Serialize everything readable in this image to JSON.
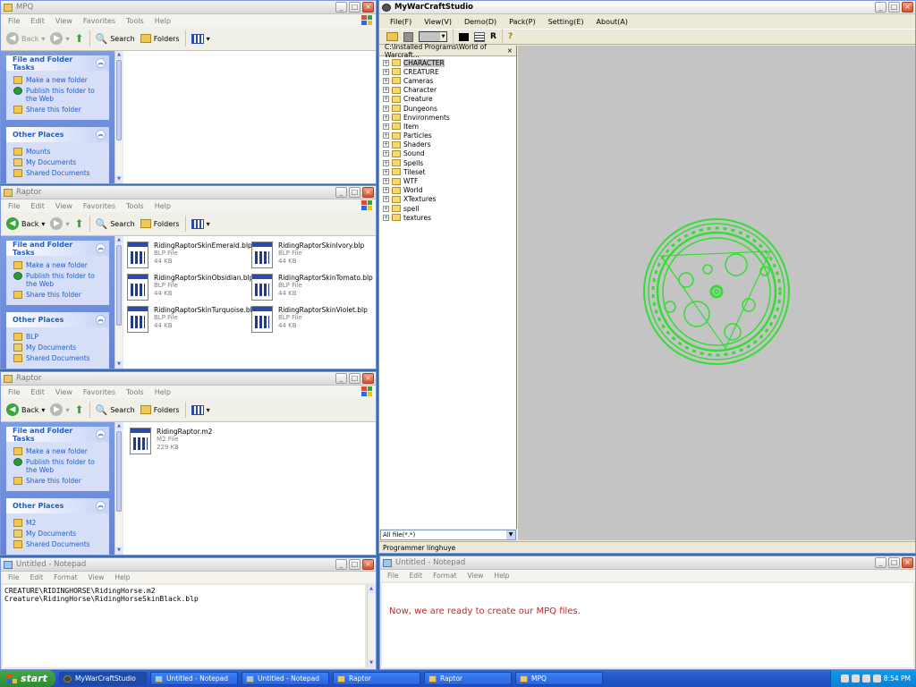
{
  "explorer_menu": [
    "File",
    "Edit",
    "View",
    "Favorites",
    "Tools",
    "Help"
  ],
  "explorer_toolbar": {
    "back": "Back",
    "search": "Search",
    "folders": "Folders"
  },
  "file_tasks_title": "File and Folder Tasks",
  "other_places_title": "Other Places",
  "tasks": [
    "Make a new folder",
    "Publish this folder to the Web",
    "Share this folder"
  ],
  "win_mpq": {
    "title": "MPQ",
    "other_places": [
      "Mounts",
      "My Documents",
      "Shared Documents"
    ]
  },
  "win_raptor1": {
    "title": "Raptor",
    "other_places": [
      "BLP",
      "My Documents",
      "Shared Documents"
    ],
    "files": [
      {
        "name": "RidingRaptorSkinEmerald.blp",
        "type": "BLP File",
        "size": "44 KB"
      },
      {
        "name": "RidingRaptorSkinIvory.blp",
        "type": "BLP File",
        "size": "44 KB"
      },
      {
        "name": "RidingRaptorSkinObsidian.blp",
        "type": "BLP File",
        "size": "44 KB"
      },
      {
        "name": "RidingRaptorSkinTomato.blp",
        "type": "BLP File",
        "size": "44 KB"
      },
      {
        "name": "RidingRaptorSkinTurquoise.blp",
        "type": "BLP File",
        "size": "44 KB"
      },
      {
        "name": "RidingRaptorSkinViolet.blp",
        "type": "BLP File",
        "size": "44 KB"
      }
    ]
  },
  "win_raptor2": {
    "title": "Raptor",
    "other_places": [
      "M2",
      "My Documents",
      "Shared Documents"
    ],
    "files": [
      {
        "name": "RidingRaptor.m2",
        "type": "M2 File",
        "size": "229 KB"
      }
    ]
  },
  "studio": {
    "title": "MyWarCraftStudio",
    "menu": [
      "File(F)",
      "View(V)",
      "Demo(D)",
      "Pack(P)",
      "Setting(E)",
      "About(A)"
    ],
    "tool_r": "R",
    "tree_path": "C:\\Installed Programs\\World of Warcraft...",
    "tree": [
      "CHARACTER",
      "CREATURE",
      "Cameras",
      "Character",
      "Creature",
      "Dungeons",
      "Environments",
      "Item",
      "Particles",
      "Shaders",
      "Sound",
      "Spells",
      "Tileset",
      "WTF",
      "World",
      "XTextures",
      "spell",
      "textures"
    ],
    "filter": "All file(*.*)",
    "status": "Programmer linghuye",
    "model_color": "#33dd33"
  },
  "notepad1": {
    "title": "Untitled - Notepad",
    "menu": [
      "File",
      "Edit",
      "Format",
      "View",
      "Help"
    ],
    "lines": [
      "CREATURE\\RIDINGHORSE\\RidingHorse.m2",
      "Creature\\RidingHorse\\RidingHorseSkinBlack.blp"
    ]
  },
  "notepad2": {
    "title": "Untitled - Notepad",
    "menu": [
      "File",
      "Edit",
      "Format",
      "View",
      "Help"
    ],
    "text": "Now, we are ready to create our MPQ files.",
    "text_color": "#cc2222"
  },
  "taskbar": {
    "start": "start",
    "items": [
      "MyWarCraftStudio",
      "Untitled - Notepad",
      "Untitled - Notepad",
      "Raptor",
      "Raptor",
      "MPQ"
    ],
    "clock": "8:54 PM"
  }
}
